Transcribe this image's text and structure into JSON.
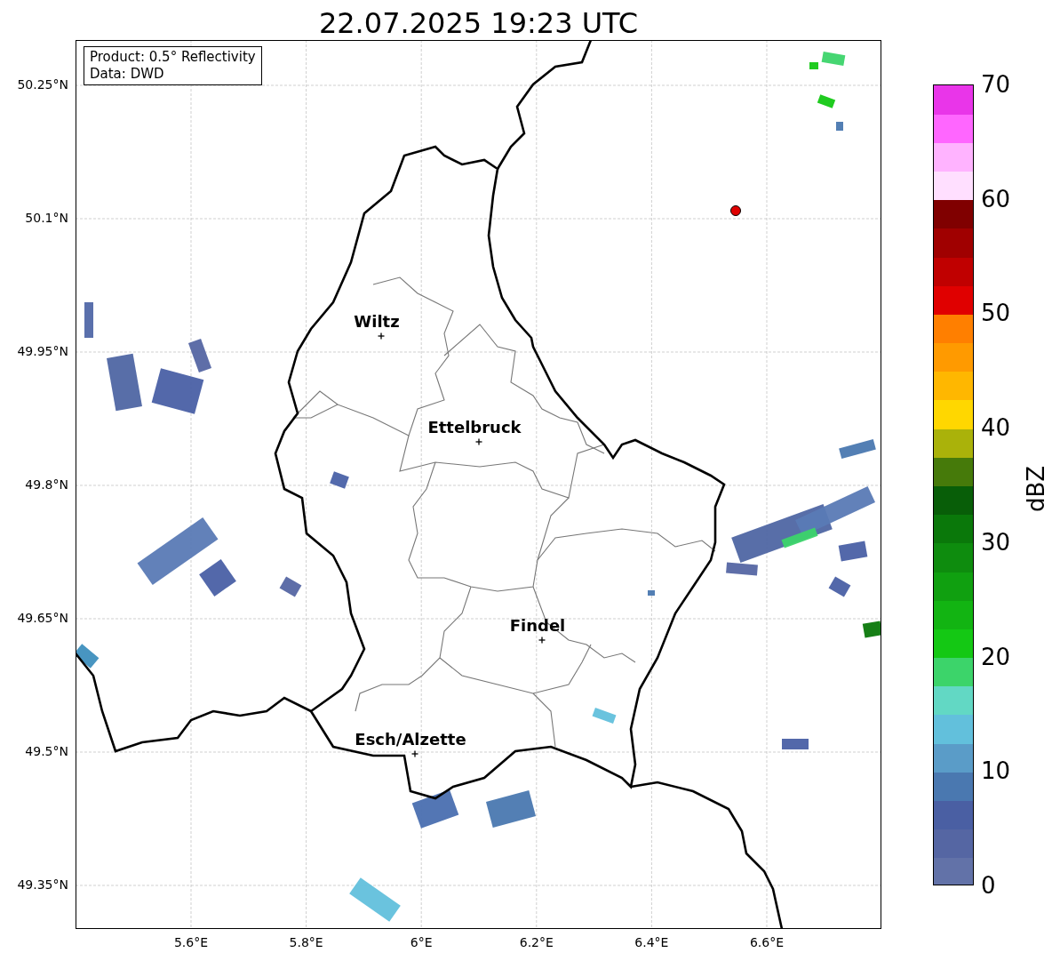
{
  "title": "22.07.2025 19:23 UTC",
  "map": {
    "legend": [
      "Product: 0.5° Reflectivity",
      "Data: DWD"
    ],
    "cities": [
      {
        "name": "Wiltz"
      },
      {
        "name": "Ettelbruck"
      },
      {
        "name": "Findel"
      },
      {
        "name": "Esch/Alzette"
      }
    ],
    "y_ticks": [
      "50.25°N",
      "50.1°N",
      "49.95°N",
      "49.8°N",
      "49.65°N",
      "49.5°N",
      "49.35°N"
    ],
    "x_ticks": [
      "5.6°E",
      "5.8°E",
      "6°E",
      "6.2°E",
      "6.4°E",
      "6.6°E"
    ]
  },
  "colorbar": {
    "label": "dBZ",
    "ticks": [
      "70",
      "60",
      "50",
      "40",
      "30",
      "20",
      "10",
      "0"
    ]
  }
}
